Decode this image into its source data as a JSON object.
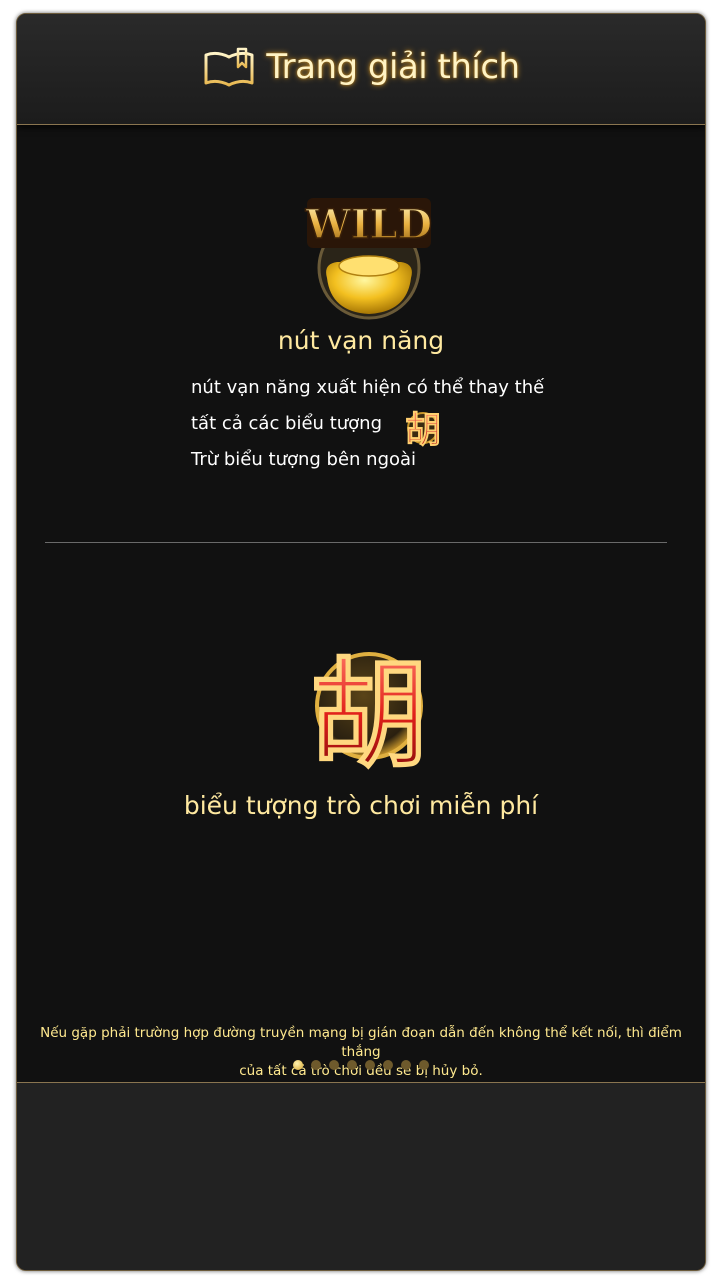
{
  "header": {
    "title": "Trang giải thích",
    "icon": "book-icon"
  },
  "wild": {
    "badge_text": "WILD",
    "title": "nút vạn năng",
    "desc_line1": "nút vạn năng xuất hiện có thể thay thế",
    "desc_line2": "tất cả các biểu tượng",
    "desc_line3": "Trừ biểu tượng bên ngoài"
  },
  "free_game": {
    "symbol_char": "胡",
    "title": "biểu tượng trò chơi miễn phí"
  },
  "notice": {
    "line1": "Nếu gặp phải trường hợp đường truyền mạng bị gián đoạn dẫn đến không thể kết nối, thì điểm thắng",
    "line2": "của tất cả trò chơi đều sẽ bị hủy bỏ."
  },
  "pagination": {
    "total": 8,
    "current": 1
  },
  "colors": {
    "accent_gold": "#ffe9a0",
    "panel_bg": "#111111"
  }
}
